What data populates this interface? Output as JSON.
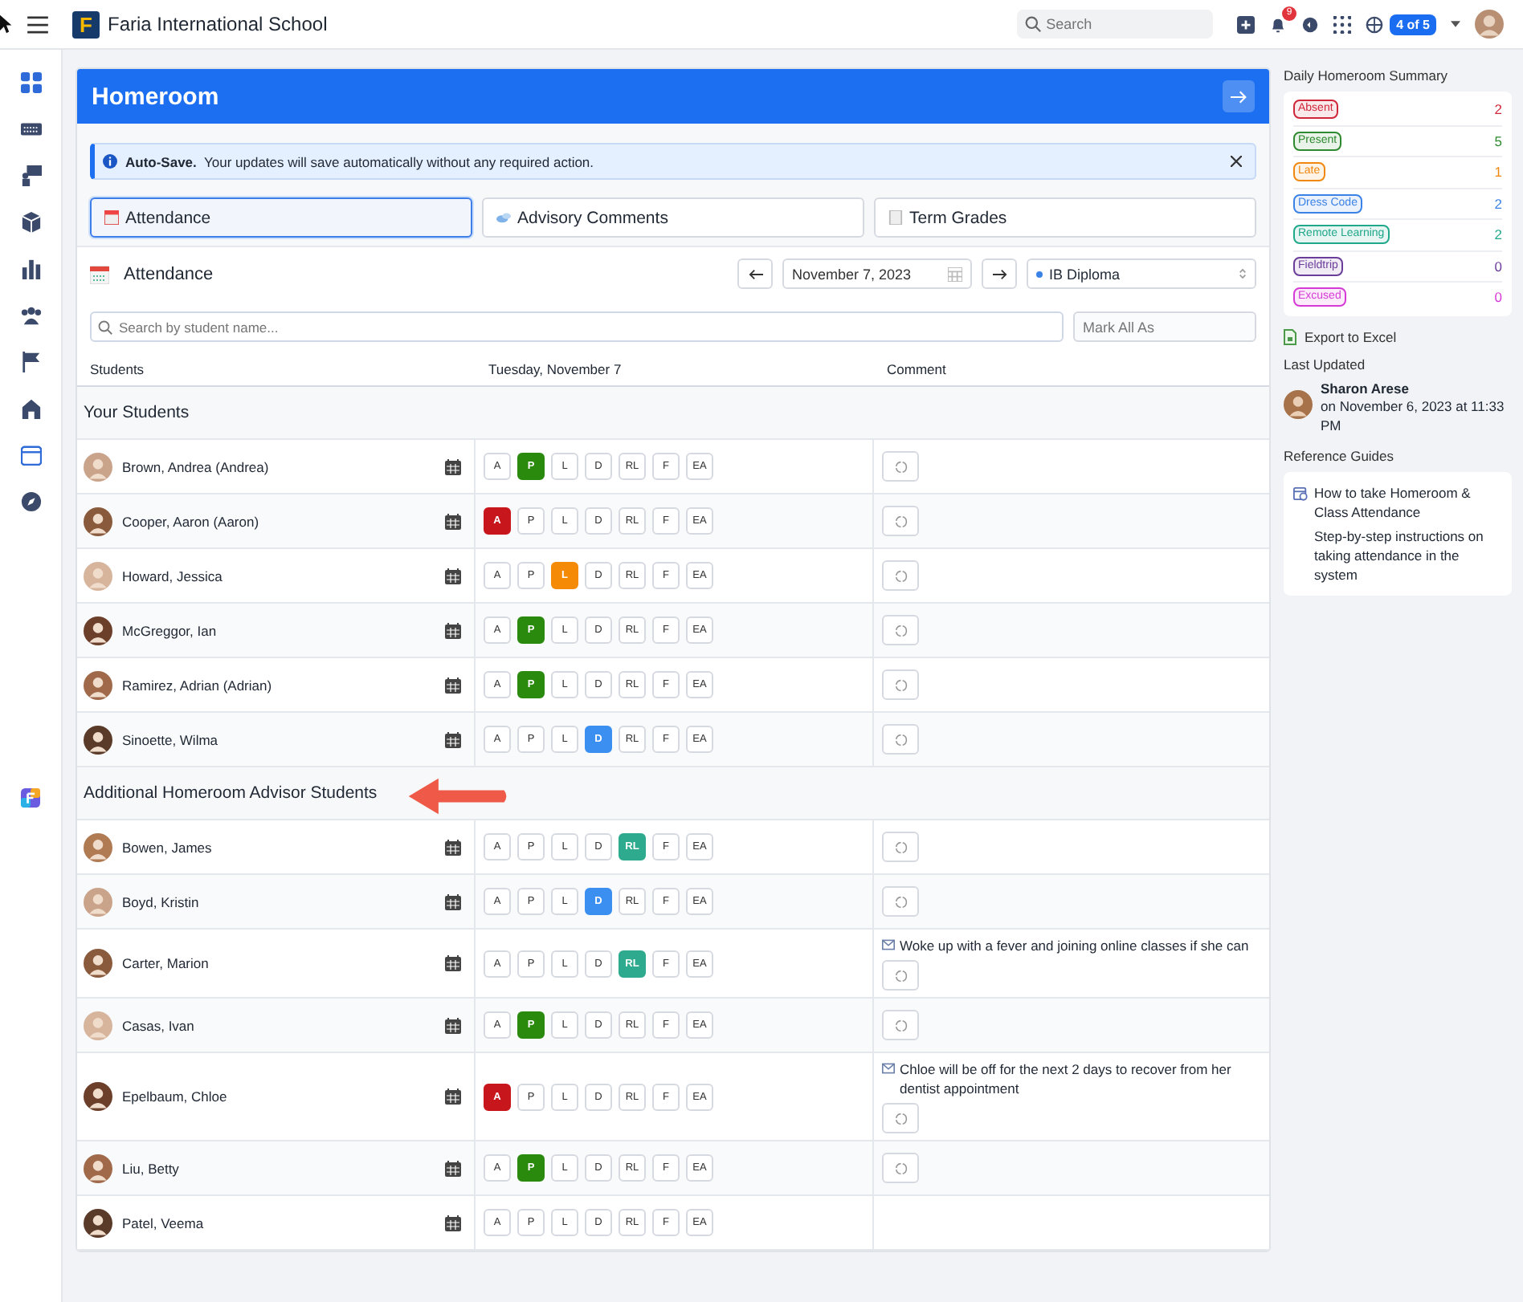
{
  "topbar": {
    "logo_letter": "F",
    "school": "Faria International School",
    "search": {
      "placeholder": "Search"
    },
    "notifications": "9",
    "account_badge": "4 of 5"
  },
  "homeroom": {
    "title": "Homeroom",
    "alert": {
      "text": "**Auto-Save.**  Your updates will save automatically without any required action."
    },
    "tabs": [
      {
        "label": "Attendance",
        "selected": true
      },
      {
        "label": "Advisory Comments",
        "selected": false
      },
      {
        "label": "Term Grades",
        "selected": false
      }
    ],
    "attendance": {
      "title": "Attendance",
      "date": "November 7, 2023",
      "program": "IB Diploma",
      "search": {
        "placeholder": "Search by student name..."
      },
      "mark_all": "Mark All As"
    },
    "columns": [
      "Students",
      "Tuesday, November 7",
      "Comment"
    ],
    "sections": [
      {
        "title": "Your Students",
        "pointer_arrow": false,
        "students": [
          {
            "name": "Brown, Andrea (Andrea)",
            "comment_button": true,
            "marks": [
              {
                "label": "A",
                "selected": false
              },
              {
                "label": "P",
                "selected": true
              },
              {
                "label": "L",
                "selected": false
              },
              {
                "label": "D",
                "selected": false
              },
              {
                "label": "RL",
                "selected": false
              },
              {
                "label": "F",
                "selected": false
              },
              {
                "label": "EA",
                "selected": false
              }
            ]
          },
          {
            "name": "Cooper, Aaron (Aaron)",
            "comment_button": true,
            "marks": [
              {
                "label": "A",
                "selected": true
              },
              {
                "label": "P",
                "selected": false
              },
              {
                "label": "L",
                "selected": false
              },
              {
                "label": "D",
                "selected": false
              },
              {
                "label": "RL",
                "selected": false
              },
              {
                "label": "F",
                "selected": false
              },
              {
                "label": "EA",
                "selected": false
              }
            ]
          },
          {
            "name": "Howard, Jessica",
            "comment_button": true,
            "marks": [
              {
                "label": "A",
                "selected": false
              },
              {
                "label": "P",
                "selected": false
              },
              {
                "label": "L",
                "selected": true
              },
              {
                "label": "D",
                "selected": false
              },
              {
                "label": "RL",
                "selected": false
              },
              {
                "label": "F",
                "selected": false
              },
              {
                "label": "EA",
                "selected": false
              }
            ]
          },
          {
            "name": "McGreggor, Ian",
            "comment_button": true,
            "marks": [
              {
                "label": "A",
                "selected": false
              },
              {
                "label": "P",
                "selected": true
              },
              {
                "label": "L",
                "selected": false
              },
              {
                "label": "D",
                "selected": false
              },
              {
                "label": "RL",
                "selected": false
              },
              {
                "label": "F",
                "selected": false
              },
              {
                "label": "EA",
                "selected": false
              }
            ]
          },
          {
            "name": "Ramirez, Adrian (Adrian)",
            "comment_button": true,
            "marks": [
              {
                "label": "A",
                "selected": false
              },
              {
                "label": "P",
                "selected": true
              },
              {
                "label": "L",
                "selected": false
              },
              {
                "label": "D",
                "selected": false
              },
              {
                "label": "RL",
                "selected": false
              },
              {
                "label": "F",
                "selected": false
              },
              {
                "label": "EA",
                "selected": false
              }
            ]
          },
          {
            "name": "Sinoette, Wilma",
            "comment_button": true,
            "marks": [
              {
                "label": "A",
                "selected": false
              },
              {
                "label": "P",
                "selected": false
              },
              {
                "label": "L",
                "selected": false
              },
              {
                "label": "D",
                "selected": true
              },
              {
                "label": "RL",
                "selected": false
              },
              {
                "label": "F",
                "selected": false
              },
              {
                "label": "EA",
                "selected": false
              }
            ]
          }
        ]
      },
      {
        "title": "Additional Homeroom Advisor Students",
        "pointer_arrow": true,
        "students": [
          {
            "name": "Bowen, James",
            "comment_button": true,
            "marks": [
              {
                "label": "A",
                "selected": false
              },
              {
                "label": "P",
                "selected": false
              },
              {
                "label": "L",
                "selected": false
              },
              {
                "label": "D",
                "selected": false
              },
              {
                "label": "RL",
                "selected": true
              },
              {
                "label": "F",
                "selected": false
              },
              {
                "label": "EA",
                "selected": false
              }
            ]
          },
          {
            "name": "Boyd, Kristin",
            "comment_button": true,
            "marks": [
              {
                "label": "A",
                "selected": false
              },
              {
                "label": "P",
                "selected": false
              },
              {
                "label": "L",
                "selected": false
              },
              {
                "label": "D",
                "selected": true
              },
              {
                "label": "RL",
                "selected": false
              },
              {
                "label": "F",
                "selected": false
              },
              {
                "label": "EA",
                "selected": false
              }
            ]
          },
          {
            "name": "Carter, Marion",
            "comment": "Woke up with a fever and joining online classes if she can",
            "comment_button": true,
            "marks": [
              {
                "label": "A",
                "selected": false
              },
              {
                "label": "P",
                "selected": false
              },
              {
                "label": "L",
                "selected": false
              },
              {
                "label": "D",
                "selected": false
              },
              {
                "label": "RL",
                "selected": true
              },
              {
                "label": "F",
                "selected": false
              },
              {
                "label": "EA",
                "selected": false
              }
            ]
          },
          {
            "name": "Casas, Ivan",
            "comment_button": true,
            "marks": [
              {
                "label": "A",
                "selected": false
              },
              {
                "label": "P",
                "selected": true
              },
              {
                "label": "L",
                "selected": false
              },
              {
                "label": "D",
                "selected": false
              },
              {
                "label": "RL",
                "selected": false
              },
              {
                "label": "F",
                "selected": false
              },
              {
                "label": "EA",
                "selected": false
              }
            ]
          },
          {
            "name": "Epelbaum, Chloe",
            "comment": "Chloe will be off for the next 2 days to recover from her dentist appointment",
            "comment_button": true,
            "marks": [
              {
                "label": "A",
                "selected": true
              },
              {
                "label": "P",
                "selected": false
              },
              {
                "label": "L",
                "selected": false
              },
              {
                "label": "D",
                "selected": false
              },
              {
                "label": "RL",
                "selected": false
              },
              {
                "label": "F",
                "selected": false
              },
              {
                "label": "EA",
                "selected": false
              }
            ]
          },
          {
            "name": "Liu, Betty",
            "comment_button": true,
            "marks": [
              {
                "label": "A",
                "selected": false
              },
              {
                "label": "P",
                "selected": true
              },
              {
                "label": "L",
                "selected": false
              },
              {
                "label": "D",
                "selected": false
              },
              {
                "label": "RL",
                "selected": false
              },
              {
                "label": "F",
                "selected": false
              },
              {
                "label": "EA",
                "selected": false
              }
            ]
          },
          {
            "name": "Patel, Veema",
            "comment_button": false,
            "marks": [
              {
                "label": "A",
                "selected": false
              },
              {
                "label": "P",
                "selected": false
              },
              {
                "label": "L",
                "selected": false
              },
              {
                "label": "D",
                "selected": false
              },
              {
                "label": "RL",
                "selected": false
              },
              {
                "label": "F",
                "selected": false
              },
              {
                "label": "EA",
                "selected": false
              }
            ]
          }
        ]
      }
    ]
  },
  "sidebar": {
    "title": "Daily Homeroom Summary",
    "summary": [
      {
        "label": "Absent",
        "count": "2",
        "color": "#d0263a"
      },
      {
        "label": "Present",
        "count": "5",
        "color": "#2e8a2e"
      },
      {
        "label": "Late",
        "count": "1",
        "color": "#f0880f"
      },
      {
        "label": "Dress Code",
        "count": "2",
        "color": "#3b82e6"
      },
      {
        "label": "Remote Learning",
        "count": "2",
        "color": "#20a88a"
      },
      {
        "label": "Fieldtrip",
        "count": "0",
        "color": "#6a3d9a"
      },
      {
        "label": "Excused",
        "count": "0",
        "color": "#d63ad6"
      }
    ],
    "export": "Export to Excel",
    "last_updated_title": "Last Updated",
    "updater": "Sharon Arese",
    "updated_on": "on November 6, 2023 at 11:33 PM",
    "guides_title": "Reference Guides",
    "guide": {
      "title": "How to take Homeroom & Class Attendance",
      "description": "Step-by-step instructions on taking attendance in the system"
    }
  }
}
